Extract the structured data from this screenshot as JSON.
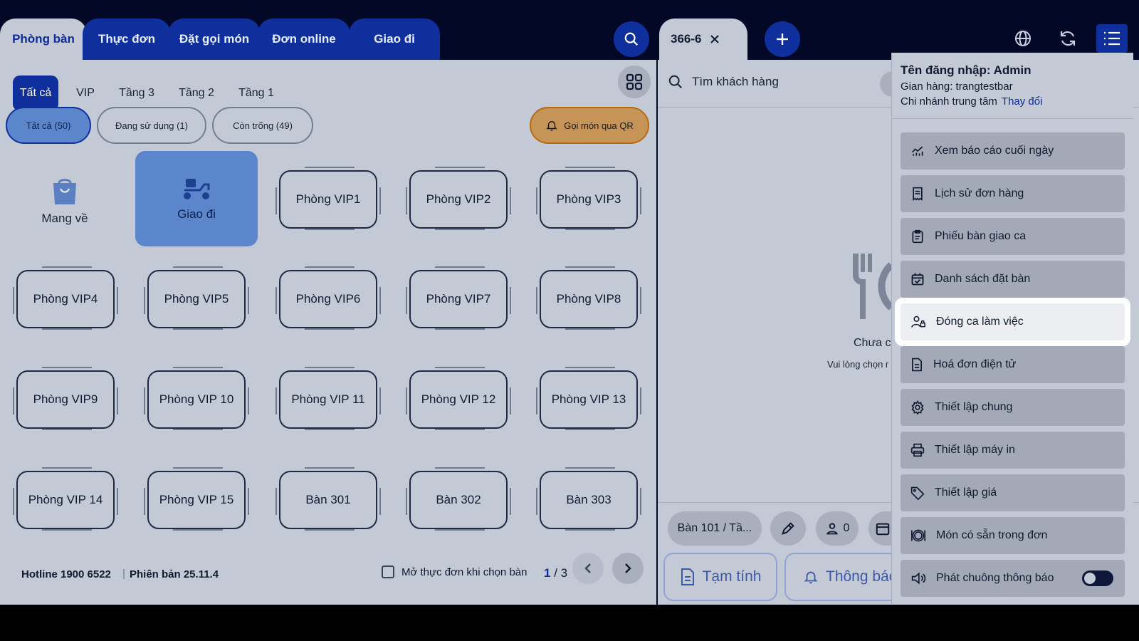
{
  "tabs": [
    {
      "label": "Phòng bàn",
      "active": true
    },
    {
      "label": "Thực đơn"
    },
    {
      "label": "Đặt gọi món"
    },
    {
      "label": "Đơn online"
    },
    {
      "label": "Giao đi"
    }
  ],
  "order_tab": {
    "label": "366-6"
  },
  "filters": {
    "floors": [
      "Tất cả",
      "VIP",
      "Tầng 3",
      "Tầng 2",
      "Tầng 1"
    ],
    "status": {
      "all": "Tất cả (50)",
      "in_use": "Đang sử dụng (1)",
      "empty": "Còn trống (49)"
    },
    "qr_button": "Gọi món qua QR"
  },
  "special_items": {
    "takeaway": "Mang về",
    "delivery": "Giao đi"
  },
  "rooms": [
    "Phòng VIP1",
    "Phòng VIP2",
    "Phòng VIP3",
    "Phòng VIP4",
    "Phòng VIP5",
    "Phòng VIP6",
    "Phòng VIP7",
    "Phòng VIP8",
    "Phòng VIP9",
    "Phòng VIP 10",
    "Phòng VIP 11",
    "Phòng VIP 12",
    "Phòng VIP 13",
    "Phòng VIP 14",
    "Phòng VIP 15",
    "Bàn 301",
    "Bàn 302",
    "Bàn 303"
  ],
  "footer": {
    "hotline": "Hotline 1900 6522",
    "version": "Phiên bản 25.11.4",
    "open_menu_checkbox": "Mở thực đơn khi chọn bàn",
    "page_current": "1",
    "page_sep": "/",
    "page_total": "3"
  },
  "order_panel": {
    "search_placeholder": "Tìm khách hàng",
    "empty_title": "Chưa c",
    "empty_hint": "Vui lòng chọn r",
    "table_chip": "Bàn 101 / Tầ...",
    "guest_count": "0",
    "temp_bill": "Tạm tính",
    "notify": "Thông báo"
  },
  "menu": {
    "username": "Tên đăng nhập: Admin",
    "store": "Gian hàng: trangtestbar",
    "branch": "Chi nhánh trung tâm",
    "change": "Thay đổi",
    "items": [
      {
        "label": "Xem báo cáo cuối ngày",
        "icon": "chart-icon"
      },
      {
        "label": "Lịch sử đơn hàng",
        "icon": "receipt-icon"
      },
      {
        "label": "Phiếu bàn giao ca",
        "icon": "clipboard-icon"
      },
      {
        "label": "Danh sách đặt bàn",
        "icon": "calendar-check-icon"
      },
      {
        "label": "Đóng ca làm việc",
        "icon": "user-lock-icon"
      },
      {
        "label": "Hoá đơn điện tử",
        "icon": "document-icon"
      },
      {
        "label": "Thiết lập chung",
        "icon": "gear-icon"
      },
      {
        "label": "Thiết lập máy in",
        "icon": "printer-icon"
      },
      {
        "label": "Thiết lập giá",
        "icon": "tag-icon"
      },
      {
        "label": "Món có sẵn trong đơn",
        "icon": "dish-icon"
      },
      {
        "label": "Phát chuông thông báo",
        "icon": "speaker-icon"
      }
    ]
  }
}
